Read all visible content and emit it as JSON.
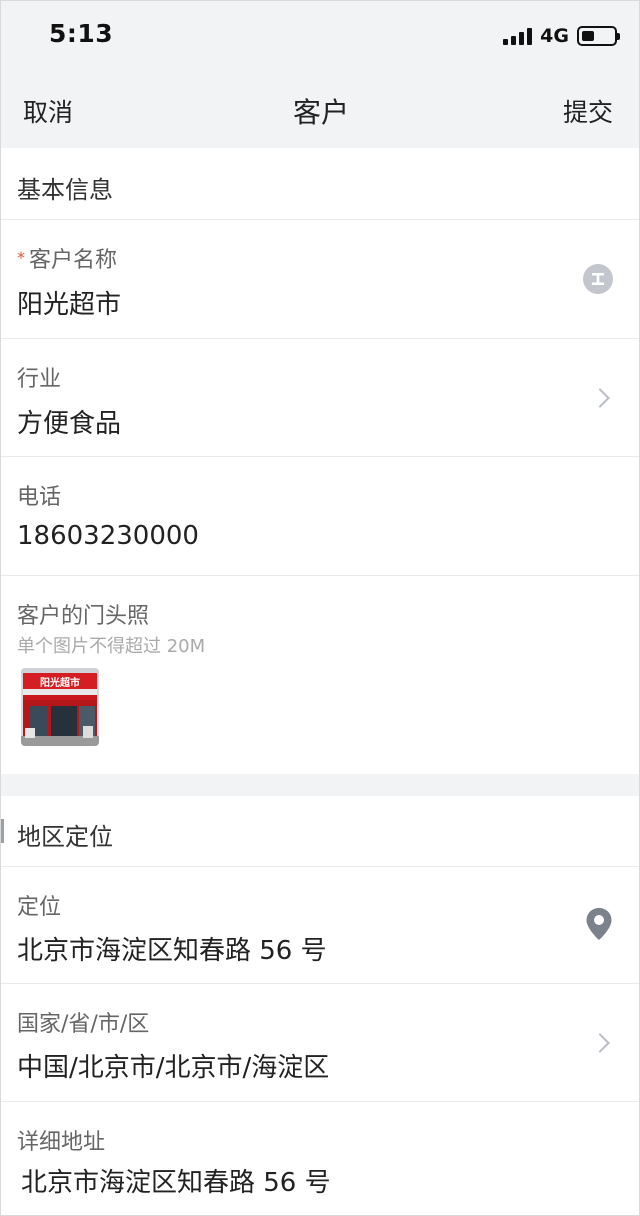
{
  "status_bar": {
    "time": "5:13",
    "network": "4G",
    "signal_icon": "cellular-signal-icon",
    "battery_icon": "battery-icon"
  },
  "nav": {
    "cancel_label": "取消",
    "title": "客户",
    "submit_label": "提交"
  },
  "basic_info": {
    "header": "基本信息",
    "customer_name": {
      "required_mark": "*",
      "label": "客户名称",
      "value": "阳光超市",
      "icon": "clear-text-icon"
    },
    "industry": {
      "label": "行业",
      "value": "方便食品",
      "icon": "chevron-right-icon"
    },
    "phone": {
      "label": "电话",
      "value": "18603230000"
    },
    "storefront_photo": {
      "label": "客户的门头照",
      "hint": "单个图片不得超过 20M",
      "sign_text": "阳光超市"
    }
  },
  "region": {
    "header": "地区定位",
    "location": {
      "label": "定位",
      "value": "北京市海淀区知春路 56 号",
      "icon": "location-pin-icon"
    },
    "area": {
      "label": "国家/省/市/区",
      "value": "中国/北京市/北京市/海淀区",
      "icon": "chevron-right-icon"
    },
    "address": {
      "label": "详细地址",
      "value": "北京市海淀区知春路 56 号"
    }
  },
  "colors": {
    "background": "#f2f3f5",
    "required": "#e0553a",
    "icon_gray": "#c3c7cd",
    "pin": "#7c828c"
  }
}
